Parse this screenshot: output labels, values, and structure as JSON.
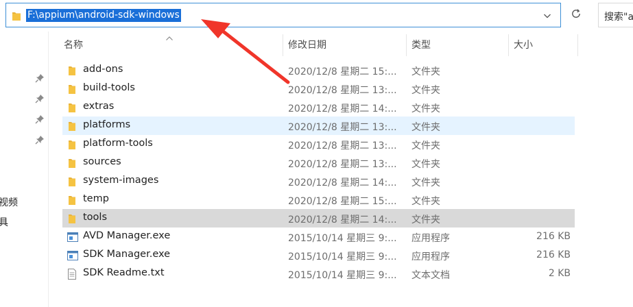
{
  "address_bar": {
    "path": "F:\\appium\\android-sdk-windows"
  },
  "search": {
    "label": "搜索\"a"
  },
  "nav_pane": {
    "items": [
      "视频",
      "具"
    ]
  },
  "columns": {
    "name": "名称",
    "date": "修改日期",
    "type": "类型",
    "size": "大小"
  },
  "files": [
    {
      "name": "add-ons",
      "date": "2020/12/8 星期二 15:...",
      "type": "文件夹",
      "size": "",
      "icon": "folder-icon"
    },
    {
      "name": "build-tools",
      "date": "2020/12/8 星期二 13:...",
      "type": "文件夹",
      "size": "",
      "icon": "folder-icon"
    },
    {
      "name": "extras",
      "date": "2020/12/8 星期二 14:...",
      "type": "文件夹",
      "size": "",
      "icon": "folder-icon"
    },
    {
      "name": "platforms",
      "date": "2020/12/8 星期二 13:...",
      "type": "文件夹",
      "size": "",
      "icon": "folder-icon"
    },
    {
      "name": "platform-tools",
      "date": "2020/12/8 星期二 13:...",
      "type": "文件夹",
      "size": "",
      "icon": "folder-icon"
    },
    {
      "name": "sources",
      "date": "2020/12/8 星期二 13:...",
      "type": "文件夹",
      "size": "",
      "icon": "folder-icon"
    },
    {
      "name": "system-images",
      "date": "2020/12/8 星期二 14:...",
      "type": "文件夹",
      "size": "",
      "icon": "folder-icon"
    },
    {
      "name": "temp",
      "date": "2020/12/8 星期二 15:...",
      "type": "文件夹",
      "size": "",
      "icon": "folder-icon"
    },
    {
      "name": "tools",
      "date": "2020/12/8 星期二 14:...",
      "type": "文件夹",
      "size": "",
      "icon": "folder-icon"
    },
    {
      "name": "AVD Manager.exe",
      "date": "2015/10/14 星期三 9:...",
      "type": "应用程序",
      "size": "216 KB",
      "icon": "exe-icon"
    },
    {
      "name": "SDK Manager.exe",
      "date": "2015/10/14 星期三 9:...",
      "type": "应用程序",
      "size": "216 KB",
      "icon": "exe-icon"
    },
    {
      "name": "SDK Readme.txt",
      "date": "2015/10/14 星期三 9:...",
      "type": "文本文档",
      "size": "2 KB",
      "icon": "text-file-icon"
    }
  ],
  "state": {
    "hover_row": 3,
    "selected_row": 8
  },
  "colors": {
    "address_highlight": "#1a6fd8",
    "address_border": "#3c8fd6",
    "folder": "#f5c342",
    "annotation_arrow": "#f0352a",
    "hover_row": "#e5f3ff",
    "selected_row": "#d9d9d9"
  }
}
